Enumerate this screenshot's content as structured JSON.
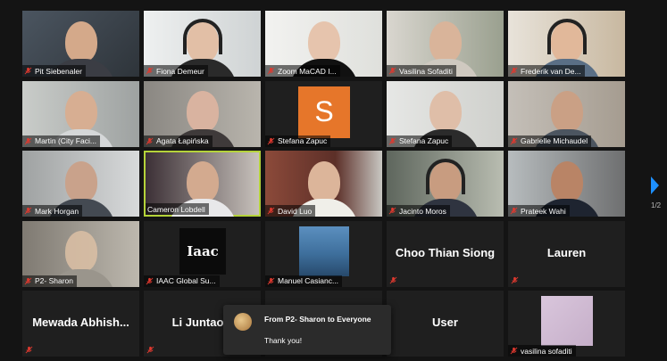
{
  "participants": [
    {
      "name": "Pit Siebenaler"
    },
    {
      "name": "Fiona Demeur"
    },
    {
      "name": "Zoom MaCAD I..."
    },
    {
      "name": "Vasilina Sofaditi"
    },
    {
      "name": "Frederik van De..."
    },
    {
      "name": "Martin (City Faci..."
    },
    {
      "name": "Agata Łapińska"
    },
    {
      "name": "Stefana Zapuc",
      "avatar": "S"
    },
    {
      "name": "Stefana Zapuc"
    },
    {
      "name": "Gabrielle Michaudel"
    },
    {
      "name": "Mark Horgan"
    },
    {
      "name": "Cameron Lobdell"
    },
    {
      "name": "David Luo"
    },
    {
      "name": "Jacinto Moros"
    },
    {
      "name": "Prateek Wahi"
    },
    {
      "name": "P2- Sharon"
    },
    {
      "name": "IAAC Global Su...",
      "logo": "Iaac"
    },
    {
      "name": "Manuel Casianc..."
    },
    {
      "display_name": "Choo Thian Siong"
    },
    {
      "display_name": "Lauren"
    },
    {
      "display_name": "Mewada  Abhish..."
    },
    {
      "display_name": "Li Juntao"
    },
    {
      "display_name": ""
    },
    {
      "display_name": "User"
    },
    {
      "name": "vasilina sofaditi"
    }
  ],
  "chat_popup": {
    "title": "From P2- Sharon to Everyone",
    "message": "Thank you!"
  },
  "pagination": {
    "indicator": "1/2"
  },
  "colors": {
    "active_speaker_border": "#b5d33a",
    "avatar_orange": "#e6762a",
    "muted_mic": "#e0392f",
    "next_arrow": "#1e90ff"
  }
}
